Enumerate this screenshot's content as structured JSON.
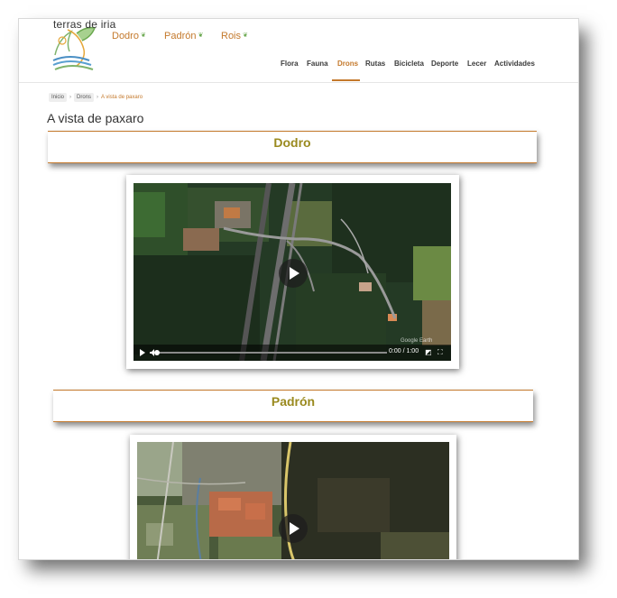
{
  "site": {
    "logo_text": "terras de iria",
    "municipalities": [
      "Dodro",
      "Padrón",
      "Rois"
    ],
    "leaf_glyph": "❦"
  },
  "nav": {
    "items": [
      "Flora",
      "Fauna",
      "Drons",
      "Rutas",
      "Bicicleta",
      "Deporte",
      "Lecer",
      "Actividades"
    ],
    "active": "Drons"
  },
  "breadcrumb": {
    "items": [
      "Inicio",
      "Drons"
    ],
    "separator": "›",
    "current": "A vista de paxaro"
  },
  "page": {
    "title": "A vista de paxaro"
  },
  "sections": [
    {
      "title": "Dodro",
      "video": {
        "time": "0:00 / 1:00",
        "watermark": "Google Earth",
        "progress": 0.0
      }
    },
    {
      "title": "Padrón",
      "video": {
        "time": "",
        "watermark": "",
        "progress": 0.0
      }
    }
  ],
  "colors": {
    "accent": "#c4792c",
    "section_title": "#9a8a1f",
    "nav_text": "#3b3b3b"
  },
  "icons": {
    "play": "play-icon",
    "volume": "volume-icon",
    "pip": "picture-in-picture-icon",
    "fullscreen": "fullscreen-icon",
    "leaf": "leaf-icon"
  }
}
